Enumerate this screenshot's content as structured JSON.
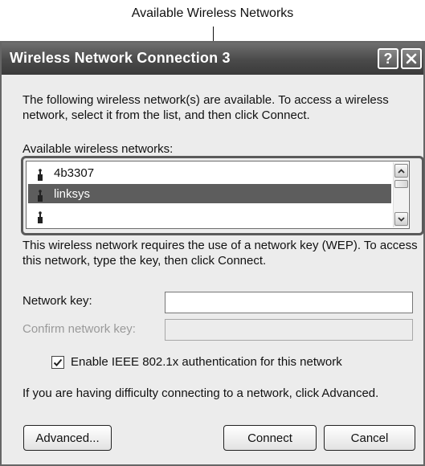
{
  "callout": {
    "label": "Available Wireless Networks"
  },
  "window": {
    "title": "Wireless Network Connection 3",
    "help_label": "?",
    "close_label": "✕"
  },
  "intro_text": "The following wireless network(s) are available. To access a wireless network, select it from the list, and then click Connect.",
  "networks_label": "Available wireless networks:",
  "networks": [
    {
      "name": "4b3307",
      "selected": false
    },
    {
      "name": "linksys",
      "selected": true
    },
    {
      "name": "",
      "selected": false
    }
  ],
  "wep_text": "This wireless network requires the use of a network key (WEP). To access this network, type the key, then click Connect.",
  "network_key": {
    "label": "Network key:",
    "value": ""
  },
  "confirm_key": {
    "label": "Confirm network key:",
    "value": ""
  },
  "ieee_checkbox": {
    "label": "Enable IEEE 802.1x authentication for this network",
    "checked": true
  },
  "advanced_hint": "If you are having difficulty connecting to a network, click Advanced.",
  "buttons": {
    "advanced": "Advanced...",
    "connect": "Connect",
    "cancel": "Cancel"
  },
  "icons": {
    "network": "wireless-network-icon",
    "help": "question-icon",
    "close": "close-icon",
    "scroll_up": "chevron-up-icon",
    "scroll_down": "chevron-down-icon",
    "check": "checkmark-icon"
  }
}
